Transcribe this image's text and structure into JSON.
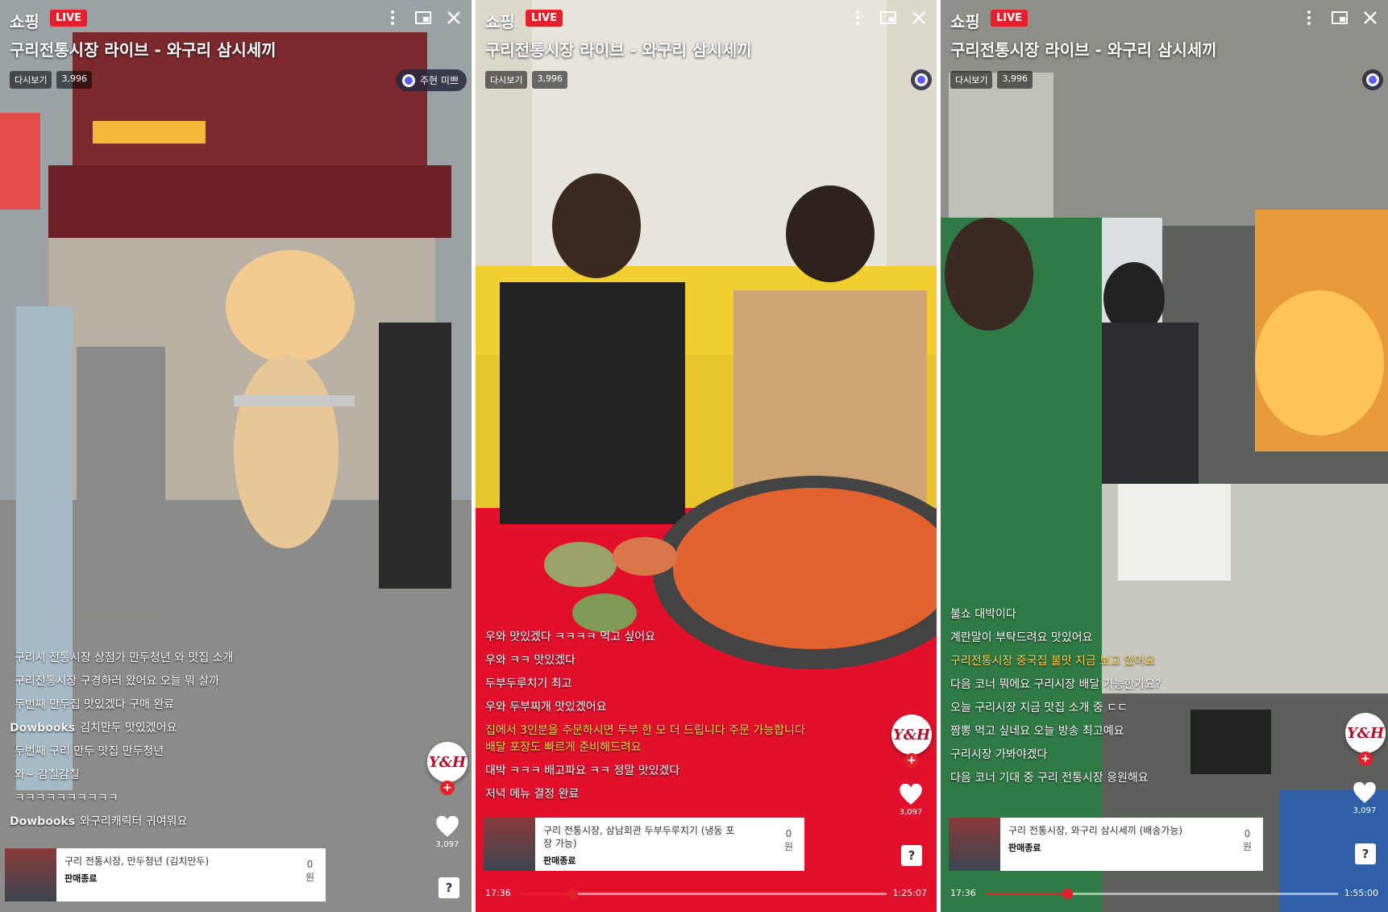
{
  "panels": [
    {
      "brand": "쇼핑",
      "live": "LIVE",
      "title": "구리전통시장 라이브 - 와구리 삼시세끼",
      "viewers": [
        "다시보기",
        "3,996"
      ],
      "host_tag": "주현 미쁘",
      "chat": [
        {
          "user": "",
          "text": "구리시 전통시장 상점가 만두청년 와 맛집 소개",
          "hl": false
        },
        {
          "user": "",
          "text": "구리전통시장 구경하러 왔어요 오늘 뭐 살까",
          "hl": false
        },
        {
          "user": "",
          "text": "두번째 만두집 맛있겠다 구매 완료",
          "hl": false
        },
        {
          "user": "Dowbooks",
          "text": "김치만두 맛있겠어요",
          "hl": false
        },
        {
          "user": "",
          "text": "두번째 구리 만두 맛집 만두청년",
          "hl": false
        },
        {
          "user": "",
          "text": "와~ 감칠감칠",
          "hl": false
        },
        {
          "user": "",
          "text": "ㅋㅋㅋㅋㅋㅋㅋㅋㅋㅋ",
          "hl": false
        },
        {
          "user": "Dowbooks",
          "text": "와구리캐릭터 귀여워요",
          "hl": false
        }
      ],
      "like_count": "3,097",
      "product": {
        "name": "구리 전통시장, 만두청년 (김치만두)",
        "seller": "판매종료",
        "price": "0",
        "unit": "원"
      },
      "progress": null
    },
    {
      "brand": "쇼핑",
      "live": "LIVE",
      "title": "구리전통시장 라이브 - 와구리 삼시세끼",
      "viewers": [
        "다시보기",
        "3,996"
      ],
      "host_tag": "",
      "chat": [
        {
          "user": "",
          "text": "우와 맛있겠다 ㅋㅋㅋㅋ 먹고 싶어요",
          "hl": false
        },
        {
          "user": "",
          "text": "우와 ㅋㅋ 맛있겠다",
          "hl": false
        },
        {
          "user": "",
          "text": "두부두루치기 최고",
          "hl": false
        },
        {
          "user": "",
          "text": "우와 두부찌개 맛있겠어요",
          "hl": false
        },
        {
          "user": "",
          "text": "집에서 3인분을 주문하시면 두부 한 모 더 드립니다 주문 가능합니다 배달 포장도 빠르게 준비해드려요",
          "hl": true
        },
        {
          "user": "",
          "text": "대박 ㅋㅋㅋ 배고파요 ㅋㅋ 정말 맛있겠다",
          "hl": false
        },
        {
          "user": "",
          "text": "저녁 메뉴 결정 완료",
          "hl": false
        }
      ],
      "like_count": "3,097",
      "product": {
        "name": "구리 전통시장, 삼남회관 두부두루치기 (냉동 포장 가능)",
        "seller": "판매종료",
        "price": "0",
        "unit": "원"
      },
      "progress": {
        "start": "17:36",
        "end": "1:25:07",
        "fraction": 0.14
      }
    },
    {
      "brand": "쇼핑",
      "live": "LIVE",
      "title": "구리전통시장 라이브 - 와구리 삼시세끼",
      "viewers": [
        "다시보기",
        "3,996"
      ],
      "host_tag": "",
      "chat": [
        {
          "user": "",
          "text": "불쇼 대박이다",
          "hl": false
        },
        {
          "user": "",
          "text": "계란말이 부탁드려요 맛있어요",
          "hl": false
        },
        {
          "user": "",
          "text": "구리전통시장 중국집 불맛 지금 보고 있어요",
          "hl": true
        },
        {
          "user": "",
          "text": "다음 코너 뭐에요 구리시장 배달 가능한가요?",
          "hl": false
        },
        {
          "user": "",
          "text": "오늘 구리시장 지금 맛집 소개 중 ㄷㄷ",
          "hl": false
        },
        {
          "user": "",
          "text": "짬뽕 먹고 싶네요 오늘 방송 최고예요",
          "hl": false
        },
        {
          "user": "",
          "text": "구리시장 가봐야겠다",
          "hl": false
        },
        {
          "user": "",
          "text": "다음 코너 기대 중 구리 전통시장 응원해요",
          "hl": false
        }
      ],
      "like_count": "3,097",
      "product": {
        "name": "구리 전통시장, 와구리 삼시세끼 (배송가능)",
        "seller": "판매종료",
        "price": "0",
        "unit": "원"
      },
      "progress": {
        "start": "17:36",
        "end": "1:55:00",
        "fraction": 0.23
      }
    }
  ],
  "rail": {
    "brand_text": "Y&H",
    "plus": "+",
    "help": "?"
  },
  "icons": {
    "more": "more-vertical-icon",
    "pip": "picture-in-picture-icon",
    "close": "close-icon",
    "heart": "heart-icon"
  }
}
